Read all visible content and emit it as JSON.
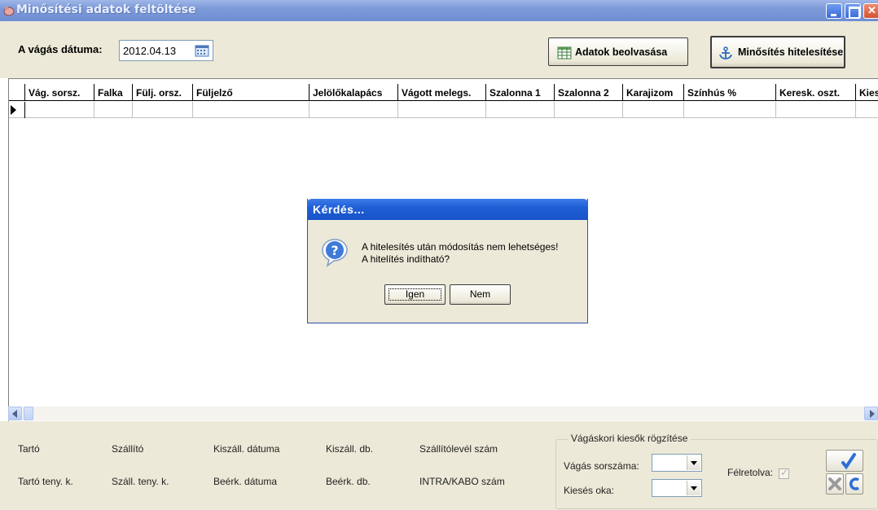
{
  "window": {
    "title": "Minősítési adatok feltöltése"
  },
  "toolbar": {
    "date_label": "A vágás dátuma:",
    "date_value": "2012.04.13",
    "read_button": "Adatok beolvasása",
    "certify_button": "Minősítés hitelesítése"
  },
  "grid": {
    "columns": [
      "Vág. sorsz.",
      "Falka",
      "Fülj. orsz.",
      "Füljelző",
      "Jelölőkalapács",
      "Vágott melegs.",
      "Szalonna 1",
      "Szalonna 2",
      "Karajizom",
      "Színhús %",
      "Keresk. oszt.",
      "Kies"
    ]
  },
  "bottom": {
    "tarto": "Tartó",
    "szallito": "Szállító",
    "kiszall_datum": "Kiszáll. dátuma",
    "kiszall_db": "Kiszáll. db.",
    "szallitolevel": "Szállítólevél szám",
    "tarto_teny": "Tartó teny. k.",
    "szall_teny": "Száll. teny. k.",
    "beerk_datum": "Beérk. dátuma",
    "beerk_db": "Beérk. db.",
    "intra": "INTRA/KABO szám"
  },
  "group": {
    "legend": "Vágáskori kiesők rögzítése",
    "vagas_sorszama": "Vágás sorszáma:",
    "kieses_oka": "Kiesés oka:",
    "felretolva": "Félretolva:"
  },
  "dialog": {
    "title": "Kérdés...",
    "line1": "A hitelesítés után módosítás nem lehetséges!",
    "line2": "A hitelítés indítható?",
    "yes_underlined": "I",
    "yes_rest": "gen",
    "no_underlined": "N",
    "no_rest": "em"
  }
}
